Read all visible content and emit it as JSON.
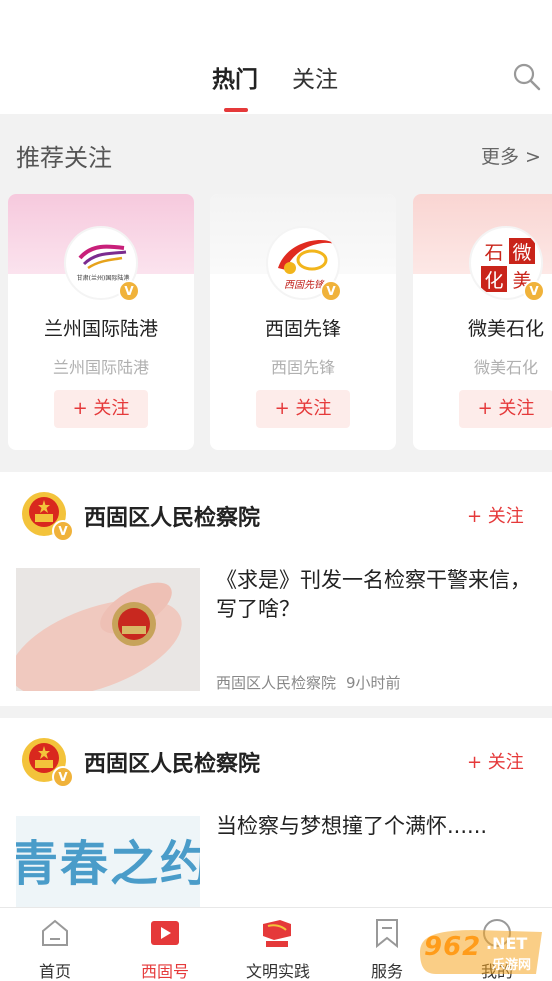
{
  "tabs": [
    {
      "label": "热门",
      "active": true
    },
    {
      "label": "关注",
      "active": false
    }
  ],
  "search_icon": "search-icon",
  "recommend": {
    "title": "推荐关注",
    "more": "更多 >",
    "cards": [
      {
        "name": "兰州国际陆港",
        "subtitle": "兰州国际陆港",
        "follow": "+ 关注",
        "logo_text": "甘肃(兰州)国际陆港",
        "verified": "V"
      },
      {
        "name": "西固先锋",
        "subtitle": "西固先锋",
        "follow": "+ 关注",
        "logo_text": "西固先锋",
        "verified": "V"
      },
      {
        "name": "微美石化",
        "subtitle": "微美石化",
        "follow": "+ 关注",
        "logo_text": [
          "石",
          "微",
          "化",
          "美"
        ],
        "verified": "V"
      }
    ]
  },
  "feed": [
    {
      "author": "西固区人民检察院",
      "follow": "+ 关注",
      "verified": "V",
      "title": "《求是》刊发一名检察干警来信，写了啥？",
      "source": "西固区人民检察院",
      "time": "9小时前"
    },
    {
      "author": "西固区人民检察院",
      "follow": "+ 关注",
      "verified": "V",
      "title": "当检察与梦想撞了个满怀......",
      "thumb_text": "青春之约"
    }
  ],
  "bottom_nav": [
    {
      "label": "首页",
      "icon": "home-icon",
      "active": false
    },
    {
      "label": "西固号",
      "icon": "play-icon",
      "active": true
    },
    {
      "label": "文明实践",
      "icon": "party-flag-icon",
      "active": false
    },
    {
      "label": "服务",
      "icon": "bookmark-icon",
      "active": false
    },
    {
      "label": "我的",
      "icon": "profile-icon",
      "active": false
    }
  ],
  "watermark": {
    "num": "962",
    "net": ".NET",
    "cn": "乐游网"
  },
  "colors": {
    "accent": "#e5393a",
    "verified": "#f0b23a",
    "follow_bg": "#fdecea"
  }
}
